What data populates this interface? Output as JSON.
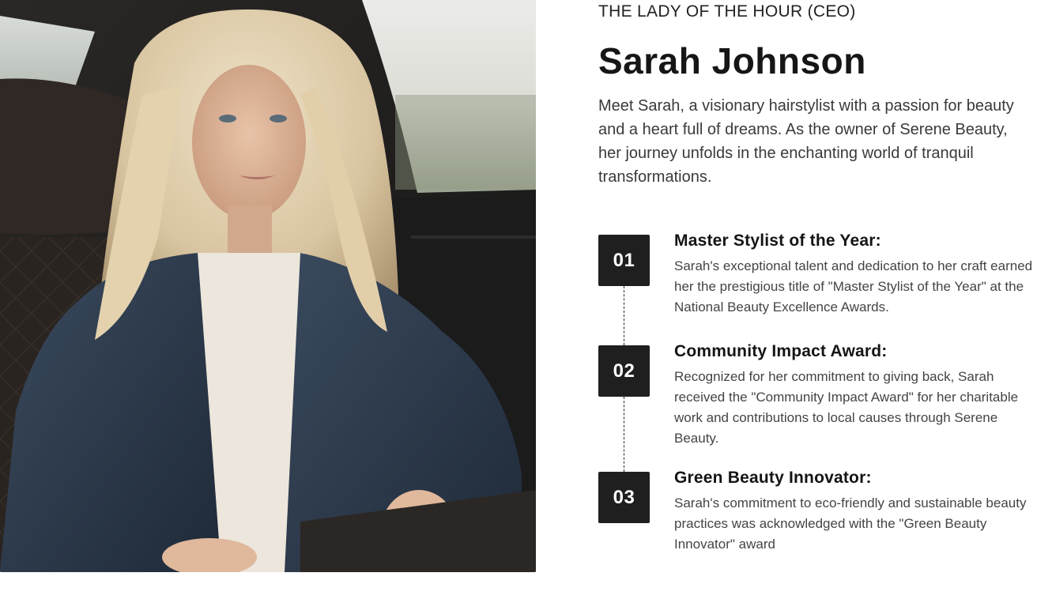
{
  "profile": {
    "eyebrow": "THE LADY OF THE HOUR (CEO)",
    "name": "Sarah Johnson",
    "intro": "Meet Sarah, a visionary hairstylist with a passion for beauty and a heart full of dreams. As the owner of Serene Beauty, her journey unfolds in the enchanting world of tranquil transformations."
  },
  "awards": [
    {
      "number": "01",
      "title": "Master Stylist of the Year:",
      "description": "Sarah's exceptional talent and dedication to her craft earned her the prestigious title of \"Master Stylist of the Year\" at the National Beauty Excellence Awards."
    },
    {
      "number": "02",
      "title": "Community Impact Award:",
      "description": "Recognized for her commitment to giving back, Sarah received the \"Community Impact Award\" for her charitable work and contributions to local causes through Serene Beauty."
    },
    {
      "number": "03",
      "title": "Green Beauty Innovator:",
      "description": "Sarah's commitment to eco-friendly and sustainable beauty practices was acknowledged with the \"Green Beauty Innovator\" award"
    }
  ],
  "colors": {
    "badge_bg": "#1f1f1f",
    "badge_text": "#ffffff",
    "heading": "#161616",
    "body_text": "#3a3a3a"
  }
}
